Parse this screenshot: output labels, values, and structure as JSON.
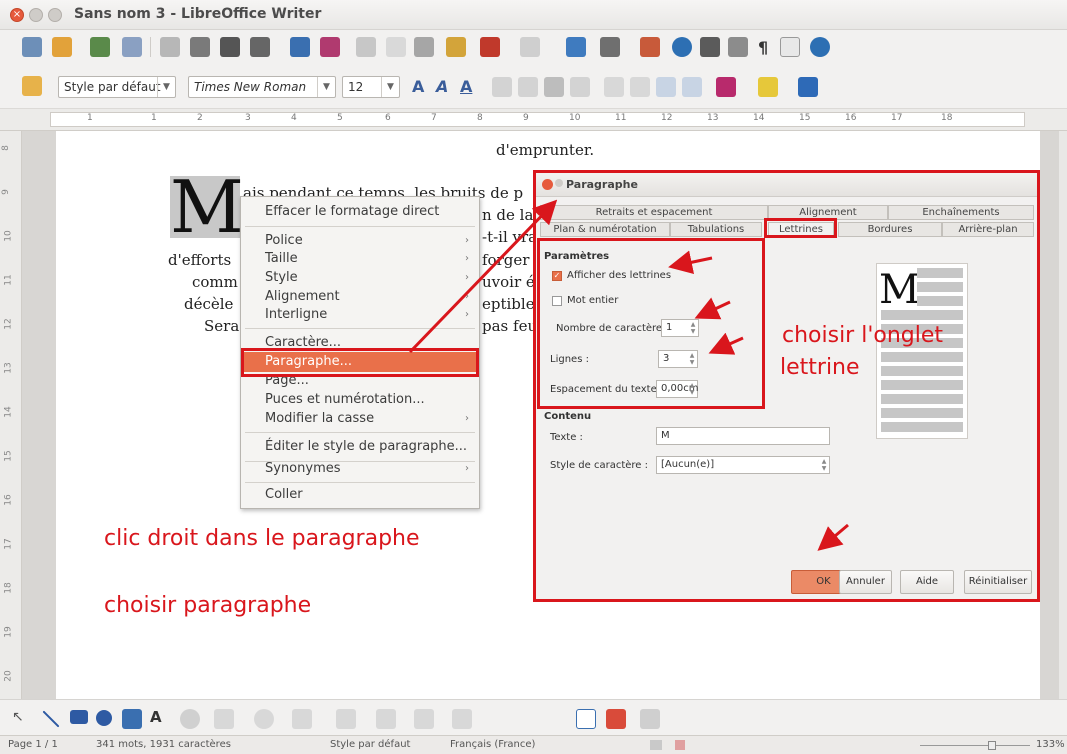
{
  "window": {
    "title": "Sans nom 3 - LibreOffice Writer"
  },
  "toolbar": {
    "paragraph_style": "Style par défaut",
    "font_name": "Times New Roman",
    "font_size": "12"
  },
  "ruler": {
    "ticks": [
      "1",
      "1",
      "2",
      "3",
      "4",
      "5",
      "6",
      "7",
      "8",
      "9",
      "10",
      "11",
      "12",
      "13",
      "14",
      "15",
      "16",
      "17",
      "18"
    ]
  },
  "vruler": {
    "ticks": [
      "8",
      "9",
      "10",
      "11",
      "12",
      "13",
      "14",
      "15",
      "16",
      "17",
      "18",
      "19",
      "20"
    ]
  },
  "document": {
    "lines": [
      "d'emprunter.",
      "ais pendant ce temps, les bruits de p",
      "n de la",
      "-t-il vra",
      "d'efforts",
      "forger s",
      "comm",
      "uvoir é",
      "décèle",
      "eptible",
      "Sera",
      "pas feut"
    ],
    "dropcap": "M"
  },
  "context_menu": {
    "items": [
      "Effacer le formatage direct",
      "Police",
      "Taille",
      "Style",
      "Alignement",
      "Interligne",
      "Caractère...",
      "Paragraphe...",
      "Page...",
      "Puces et numérotation...",
      "Modifier la casse",
      "Éditer le style de paragraphe...",
      "Synonymes",
      "Coller"
    ]
  },
  "dialog": {
    "title": "Paragraphe",
    "tabs_row1": [
      "Retraits et espacement",
      "Alignement",
      "Enchaînements"
    ],
    "tabs_row2": [
      "Plan & numérotation",
      "Tabulations",
      "Lettrines",
      "Bordures",
      "Arrière-plan"
    ],
    "params_header": "Paramètres",
    "show_dropcaps": "Afficher des lettrines",
    "whole_word": "Mot entier",
    "num_chars_label": "Nombre de caractères :",
    "num_chars_value": "1",
    "lines_label": "Lignes :",
    "lines_value": "3",
    "spacing_label": "Espacement du texte :",
    "spacing_value": "0,00cm",
    "content_header": "Contenu",
    "text_label": "Texte :",
    "text_value": "M",
    "char_style_label": "Style de caractère :",
    "char_style_value": "[Aucun(e)]",
    "preview_letter": "M",
    "buttons": {
      "ok": "OK",
      "cancel": "Annuler",
      "help": "Aide",
      "reset": "Réinitialiser"
    }
  },
  "annotations": {
    "choose_tab_1": "choisir l'onglet",
    "choose_tab_2": "lettrine",
    "right_click": "clic droit dans le paragraphe",
    "choose_paragraph": "choisir paragraphe",
    "color": "#d9161c"
  },
  "status": {
    "page": "Page 1 / 1",
    "words": "341 mots, 1931 caractères",
    "style": "Style par défaut",
    "language": "Français (France)",
    "zoom": "133%"
  }
}
